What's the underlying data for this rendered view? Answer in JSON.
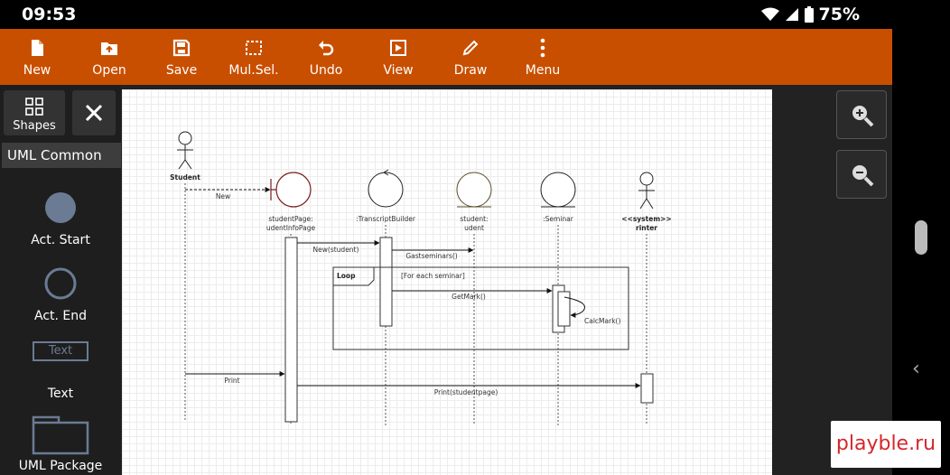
{
  "status_bar": {
    "time": "09:53",
    "battery": "75%"
  },
  "toolbar": {
    "new": "New",
    "open": "Open",
    "save": "Save",
    "mulsel": "Mul.Sel.",
    "undo": "Undo",
    "view": "View",
    "draw": "Draw",
    "menu": "Menu"
  },
  "sidebar": {
    "shapes_label": "Shapes",
    "category": "UML Common",
    "items": [
      {
        "label": "Act. Start"
      },
      {
        "label": "Act. End"
      },
      {
        "label": "Text",
        "preview": "Text"
      },
      {
        "label": "UML Package"
      }
    ]
  },
  "diagram": {
    "actor_student": "Student",
    "lifeline_page": [
      "studentPage:",
      "udentInfoPage"
    ],
    "lifeline_builder": ":TranscriptBuilder",
    "lifeline_student": [
      "student:",
      "udent"
    ],
    "lifeline_seminar": ":Seminar",
    "lifeline_printer": [
      "<<system>>",
      "rinter"
    ],
    "msg_new": "New",
    "msg_new_student": "New(student)",
    "msg_get_seminars": "Gastseminars()",
    "loop_label": "Loop",
    "loop_guard": "[For each seminar]",
    "msg_get_mark": "GetMark()",
    "msg_calc_mark": "CalcMark()",
    "msg_print": "Print",
    "msg_print_student": "Print(studentpage)"
  },
  "watermark": "playble.ru"
}
